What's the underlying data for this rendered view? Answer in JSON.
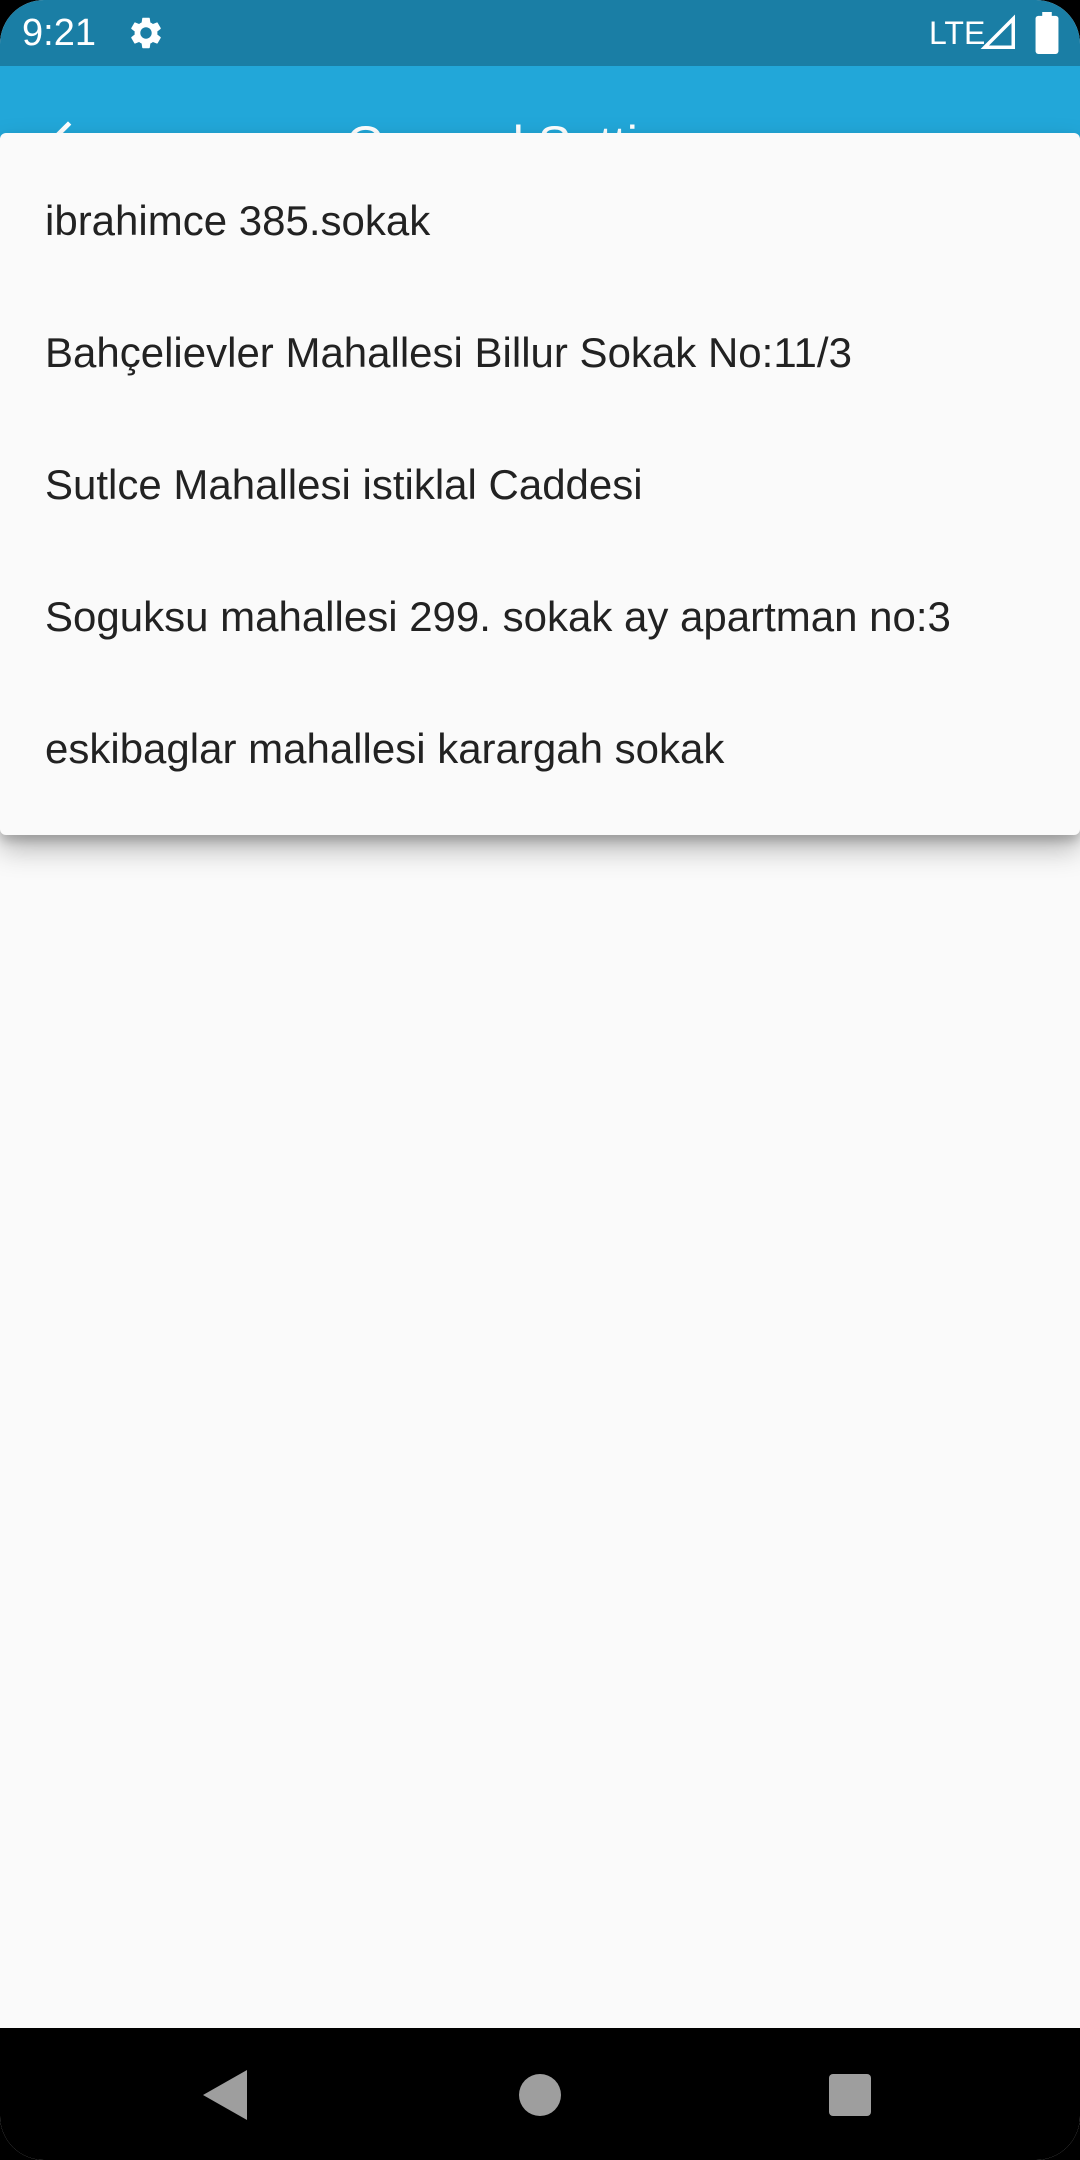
{
  "status_bar": {
    "time": "9:21",
    "network": "LTE",
    "icons": [
      "gear-icon",
      "signal-icon",
      "battery-icon"
    ]
  },
  "app_bar": {
    "title": "General Settings",
    "back_icon": "arrow-back-icon",
    "color": "#22a7d9"
  },
  "address_menu": {
    "items": [
      {
        "label": "ibrahimce 385.sokak"
      },
      {
        "label": "Bahçelievler Mahallesi Billur Sokak No:11/3"
      },
      {
        "label": "Sutlce Mahallesi istiklal Caddesi"
      },
      {
        "label": "Soguksu mahallesi 299. sokak ay apartman no:3"
      },
      {
        "label": "eskibaglar mahallesi karargah sokak"
      }
    ]
  },
  "nav_bar": {
    "buttons": [
      "back-triangle-icon",
      "home-circle-icon",
      "recents-square-icon"
    ]
  },
  "colors": {
    "status_bar": "#1a7ea5",
    "app_bar": "#22a7d9",
    "background": "#fafafa",
    "menu_text": "#222222"
  }
}
